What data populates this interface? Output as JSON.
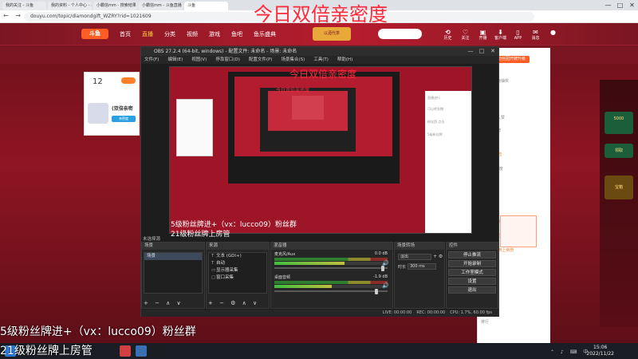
{
  "browser": {
    "tabs": [
      "我的关注 - 斗鱼",
      "我的资料 - 个人中心 - 斗鱼",
      "小霸信mm - 搜索结果 - 斗鱼",
      "小霸信mm - 斗鱼直播",
      "斗鱼"
    ],
    "url": "douyu.com/topic/diamondgift_WZRY?rid=1021609",
    "win_min": "—",
    "win_max": "□",
    "win_close": "✕",
    "nav_arrows": "← → ⟳"
  },
  "douyu": {
    "logo": "斗鱼",
    "nav": [
      "首页",
      "直播",
      "分类",
      "视频",
      "游戏",
      "鱼吧",
      "鱼乐盛典"
    ],
    "active_nav": "直播",
    "award_label": "以酒代茶",
    "search_placeholder": "",
    "header_icons": [
      {
        "icon": "history-icon",
        "label": "历史"
      },
      {
        "icon": "follow-icon",
        "label": "关注"
      },
      {
        "icon": "live-icon",
        "label": "开播"
      },
      {
        "icon": "client-icon",
        "label": "客户端"
      },
      {
        "icon": "app-icon",
        "label": "APP"
      },
      {
        "icon": "message-icon",
        "label": "消息"
      },
      {
        "icon": "avatar-icon",
        "label": ""
      }
    ],
    "card": {
      "count": "12",
      "name": "(双倍亲密",
      "badge": "亲密度"
    },
    "big_title": "今日双倍亲密度",
    "chat_button": "粉丝团开牌升级",
    "chat_lines": [
      "直播进行",
      "左侧送礼物抽奖",
      "点击领取",
      "赞",
      "这都谁加入赞",
      "可以转发赠",
      "本场排名",
      "粉丝团 点击 ",
      "1000亲密度",
      "5级粉丝牌",
      "今日可领",
      "公告",
      "免费送 开播",
      "加入粉丝团",
      "21级粉丝牌上房管",
      "排行"
    ],
    "sidebar_badges": [
      "5000",
      "领取",
      "宝箱"
    ]
  },
  "overlay": {
    "line1": "5级粉丝牌进+（vx：lucco09）粉丝群",
    "line2": "21级粉丝牌上房管"
  },
  "obs": {
    "title": "OBS 27.2.4 (64-bit, windows) - 配置文件: 未命名 - 场景: 未命名",
    "menu": [
      "文件(F)",
      "编辑(E)",
      "视图(V)",
      "停靠窗口(D)",
      "配置文件(P)",
      "场景集合(S)",
      "工具(T)",
      "帮助(H)"
    ],
    "preview_title": "今日双倍亲密度",
    "preview_overlay1": "5级粉丝牌进+（vx：lucco09）粉丝群",
    "preview_overlay2": "21级粉丝牌上房管",
    "no_source": "未选择源",
    "docks": {
      "scenes": {
        "title": "场景",
        "items": [
          "场景"
        ]
      },
      "sources": {
        "title": "来源",
        "items": [
          {
            "icon": "text-icon",
            "label": "文本 (GDI+)"
          },
          {
            "icon": "text-icon",
            "label": "自动"
          },
          {
            "icon": "display-icon",
            "label": "显示器采集"
          },
          {
            "icon": "window-icon",
            "label": "窗口采集"
          }
        ]
      },
      "mixer": {
        "title": "混音器",
        "channels": [
          {
            "name": "麦克风/Aux",
            "db": "0.0 dB"
          },
          {
            "name": "桌面音频",
            "db": "-1.9 dB"
          }
        ]
      },
      "transitions": {
        "title": "场景转场",
        "type": "淡出",
        "duration_label": "时长",
        "duration": "300 ms"
      },
      "controls": {
        "title": "控件",
        "buttons": [
          "停止推流",
          "开始录制",
          "工作室模式",
          "设置",
          "退出"
        ]
      }
    },
    "status": {
      "live": "LIVE: 00:00:00",
      "rec": "REC: 00:00:00",
      "cpu": "CPU: 1.7%, 60.00 fps"
    }
  },
  "taskbar": {
    "time": "15:06",
    "date": "2022/11/22",
    "tray": "⌃ ♪ ⌨ 中"
  }
}
